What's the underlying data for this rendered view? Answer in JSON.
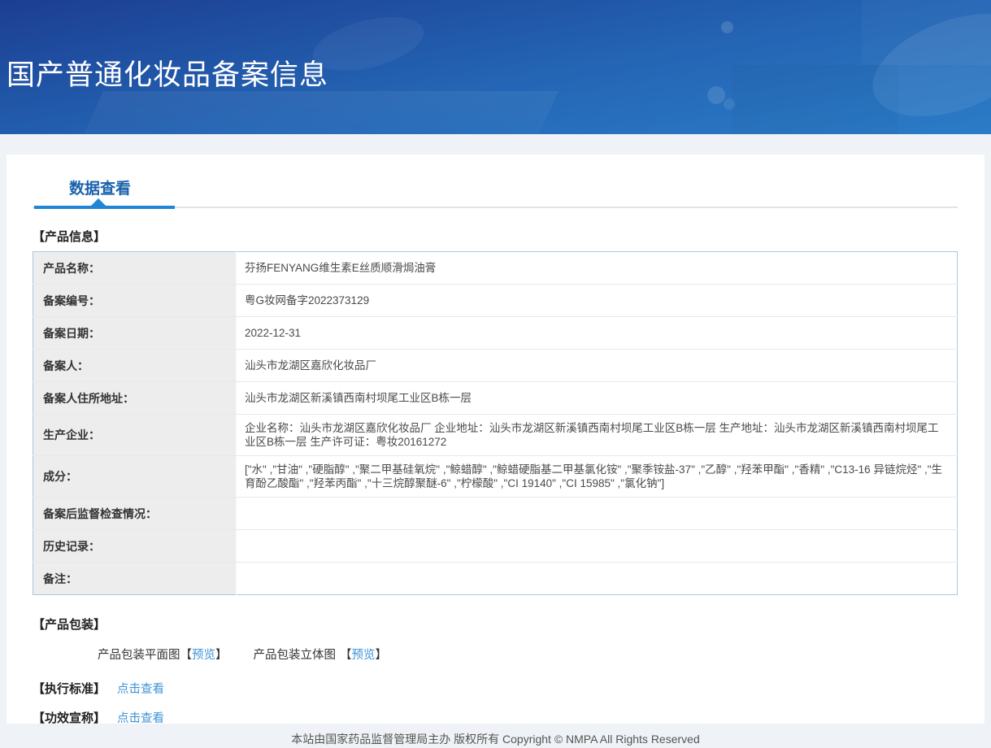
{
  "header": {
    "title": "国产普通化妆品备案信息"
  },
  "tab": {
    "label": "数据查看"
  },
  "product_info": {
    "heading": "【产品信息】",
    "rows": [
      {
        "label": "产品名称：",
        "value": "芬扬FENYANG维生素E丝质顺滑焗油膏"
      },
      {
        "label": "备案编号：",
        "value": "粤G妆网备字2022373129"
      },
      {
        "label": "备案日期：",
        "value": "2022-12-31"
      },
      {
        "label": "备案人：",
        "value": "汕头市龙湖区嘉欣化妆品厂"
      },
      {
        "label": "备案人住所地址：",
        "value": "汕头市龙湖区新溪镇西南村坝尾工业区B栋一层"
      },
      {
        "label": "生产企业：",
        "value": "企业名称：汕头市龙湖区嘉欣化妆品厂 企业地址：汕头市龙湖区新溪镇西南村坝尾工业区B栋一层 生产地址：汕头市龙湖区新溪镇西南村坝尾工业区B栋一层 生产许可证：粤妆20161272"
      },
      {
        "label": "成分：",
        "value": "[\"水\" ,\"甘油\" ,\"硬脂醇\" ,\"聚二甲基硅氧烷\" ,\"鲸蜡醇\" ,\"鲸蜡硬脂基二甲基氯化铵\" ,\"聚季铵盐-37\" ,\"乙醇\" ,\"羟苯甲酯\" ,\"香精\" ,\"C13-16 异链烷烃\" ,\"生育酚乙酸酯\" ,\"羟苯丙酯\" ,\"十三烷醇聚醚-6\" ,\"柠檬酸\" ,\"CI 19140\" ,\"CI 15985\" ,\"氯化钠\"]"
      },
      {
        "label": "备案后监督检查情况：",
        "value": ""
      },
      {
        "label": "历史记录：",
        "value": ""
      },
      {
        "label": "备注：",
        "value": ""
      }
    ]
  },
  "packaging": {
    "heading": "【产品包装】",
    "flat_label": "产品包装平面图",
    "stereo_label": "产品包装立体图",
    "bracket_open": "【",
    "bracket_close": "】",
    "preview_link": "预览"
  },
  "standard": {
    "heading": "【执行标准】",
    "link": "点击查看"
  },
  "efficacy": {
    "heading": "【功效宣称】",
    "link": "点击查看"
  },
  "footer": {
    "text": "本站由国家药品监督管理局主办 版权所有 Copyright © NMPA All Rights Reserved"
  },
  "colors": {
    "accent_blue": "#1f86d6",
    "tab_text_blue": "#1a62ad",
    "link_blue": "#3e93d6",
    "header_gradient_top": "#1c3e92",
    "header_gradient_bottom": "#2b7cc7",
    "table_border": "#a9c7e5",
    "label_cell_bg": "#ededed"
  }
}
